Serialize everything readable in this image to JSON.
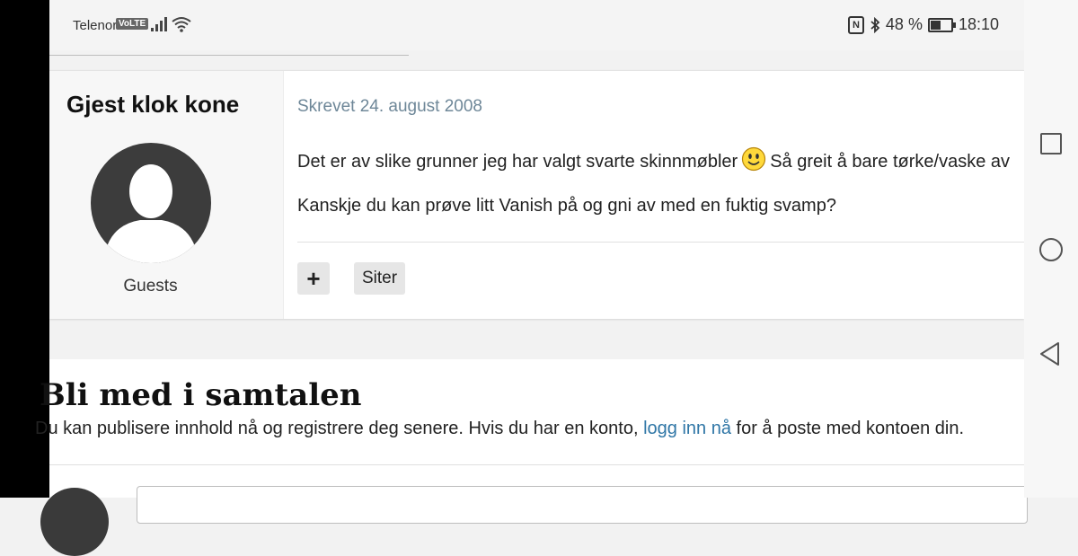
{
  "status_bar": {
    "carrier": "Telenor",
    "volte": "VoLTE",
    "battery_percent": "48 %",
    "battery_level": 0.48,
    "time": "18:10"
  },
  "post": {
    "author": "Gjest klok kone",
    "role": "Guests",
    "date": "Skrevet 24. august 2008",
    "text1_before": "Det er av slike grunner jeg har valgt svarte skinnmøbler",
    "text1_after": "Så greit å bare tørke/vaske av",
    "text2": "Kanskje du kan prøve litt Vanish på og gni av med en fuktig svamp?",
    "plus_label": "+",
    "quote_label": "Siter"
  },
  "join": {
    "title": "Bli med i samtalen",
    "text_before": "Du kan publisere innhold nå og registrere deg senere. Hvis du har en konto,",
    "link": "logg inn nå",
    "text_after": "for å poste med kontoen din."
  },
  "icons": {
    "signal": "signal-icon",
    "wifi": "wifi-icon",
    "nfc": "nfc-icon",
    "bluetooth": "bluetooth-icon",
    "battery": "battery-icon",
    "smiley": "smiley-icon",
    "nav_recent": "square-icon",
    "nav_home": "circle-icon",
    "nav_back": "triangle-back-icon"
  }
}
